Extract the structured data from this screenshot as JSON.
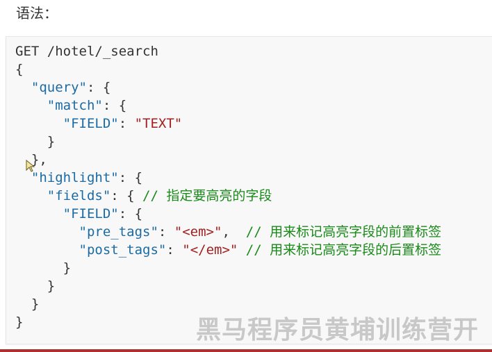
{
  "heading": "语法：",
  "code": {
    "lines": [
      [
        {
          "t": "GET /hotel/_search",
          "c": "p"
        }
      ],
      [
        {
          "t": "{",
          "c": "p"
        }
      ],
      [
        {
          "t": "  ",
          "c": "p"
        },
        {
          "t": "\"query\"",
          "c": "k"
        },
        {
          "t": ": {",
          "c": "p"
        }
      ],
      [
        {
          "t": "    ",
          "c": "p"
        },
        {
          "t": "\"match\"",
          "c": "k"
        },
        {
          "t": ": {",
          "c": "p"
        }
      ],
      [
        {
          "t": "      ",
          "c": "p"
        },
        {
          "t": "\"FIELD\"",
          "c": "k"
        },
        {
          "t": ": ",
          "c": "p"
        },
        {
          "t": "\"TEXT\"",
          "c": "s"
        }
      ],
      [
        {
          "t": "    }",
          "c": "p"
        }
      ],
      [
        {
          "t": "  },",
          "c": "p"
        }
      ],
      [
        {
          "t": "  ",
          "c": "p"
        },
        {
          "t": "\"highlight\"",
          "c": "k"
        },
        {
          "t": ": {",
          "c": "p"
        }
      ],
      [
        {
          "t": "    ",
          "c": "p"
        },
        {
          "t": "\"fields\"",
          "c": "k"
        },
        {
          "t": ": { ",
          "c": "p"
        },
        {
          "t": "// 指定要高亮的字段",
          "c": "c"
        }
      ],
      [
        {
          "t": "      ",
          "c": "p"
        },
        {
          "t": "\"FIELD\"",
          "c": "k"
        },
        {
          "t": ": {",
          "c": "p"
        }
      ],
      [
        {
          "t": "        ",
          "c": "p"
        },
        {
          "t": "\"pre_tags\"",
          "c": "k"
        },
        {
          "t": ": ",
          "c": "p"
        },
        {
          "t": "\"<em>\"",
          "c": "s"
        },
        {
          "t": ",  ",
          "c": "p"
        },
        {
          "t": "// 用来标记高亮字段的前置标签",
          "c": "c"
        }
      ],
      [
        {
          "t": "        ",
          "c": "p"
        },
        {
          "t": "\"post_tags\"",
          "c": "k"
        },
        {
          "t": ": ",
          "c": "p"
        },
        {
          "t": "\"</em>\"",
          "c": "s"
        },
        {
          "t": " ",
          "c": "p"
        },
        {
          "t": "// 用来标记高亮字段的后置标签",
          "c": "c"
        }
      ],
      [
        {
          "t": "      }",
          "c": "p"
        }
      ],
      [
        {
          "t": "    }",
          "c": "p"
        }
      ],
      [
        {
          "t": "  }",
          "c": "p"
        }
      ],
      [
        {
          "t": "}",
          "c": "p"
        }
      ]
    ]
  },
  "watermark": "黑马程序员黄埔训练营开",
  "colors": {
    "key": "#1c6aa3",
    "string": "#a11f1f",
    "comment": "#1a8a1a",
    "accent_bar": "#b03030"
  },
  "icons": {
    "cursor": "mouse-pointer-icon"
  }
}
